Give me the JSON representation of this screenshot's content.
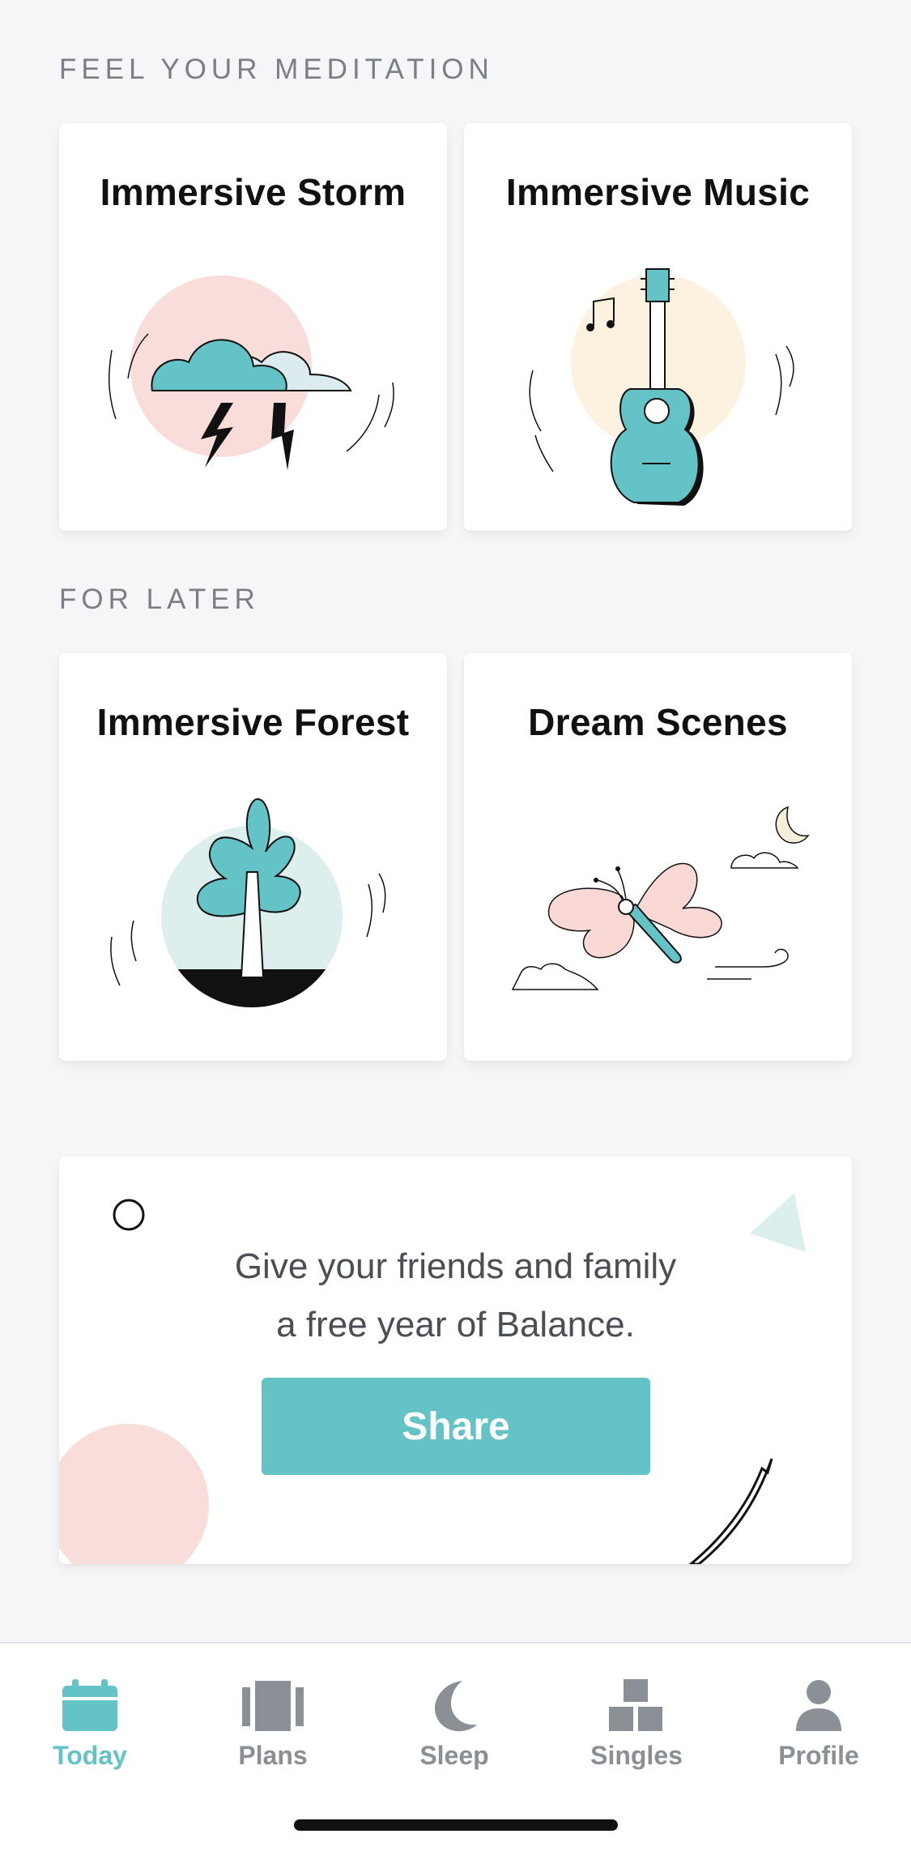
{
  "sections": {
    "feel": "FEEL YOUR MEDITATION",
    "later": "FOR LATER"
  },
  "tiles": [
    {
      "title": "Immersive Storm",
      "icon": "storm-cloud-illustration"
    },
    {
      "title": "Immersive Music",
      "icon": "guitar-illustration"
    },
    {
      "title": "Immersive Forest",
      "icon": "tree-illustration"
    },
    {
      "title": "Dream Scenes",
      "icon": "butterfly-illustration"
    }
  ],
  "promo": {
    "line1": "Give your friends and family",
    "line2": "a free year of Balance.",
    "button": "Share"
  },
  "tabs": [
    {
      "label": "Today",
      "icon": "calendar-icon",
      "active": true
    },
    {
      "label": "Plans",
      "icon": "plans-icon",
      "active": false
    },
    {
      "label": "Sleep",
      "icon": "moon-icon",
      "active": false
    },
    {
      "label": "Singles",
      "icon": "blocks-icon",
      "active": false
    },
    {
      "label": "Profile",
      "icon": "person-icon",
      "active": false
    }
  ],
  "colors": {
    "accent": "#63c3c6",
    "pink": "#f9ddda",
    "cream": "#fdf1df",
    "mint": "#dcefec",
    "muted": "#8a9096"
  }
}
